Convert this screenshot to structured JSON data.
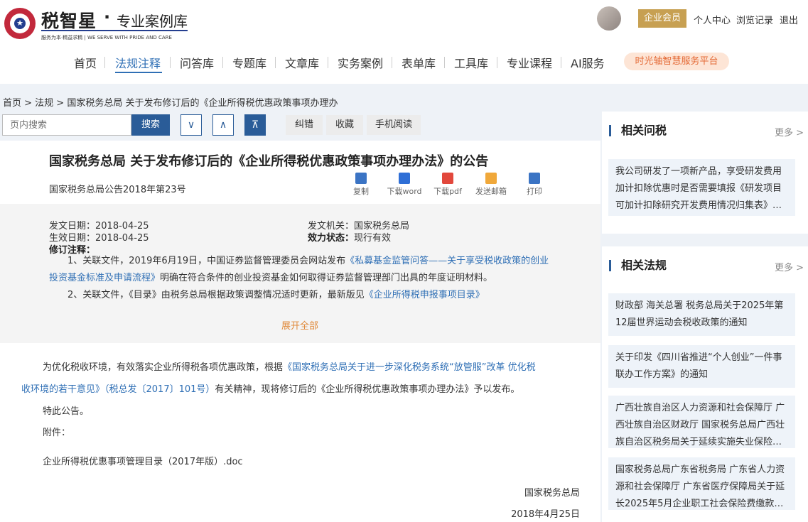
{
  "header": {
    "brand": "税智星",
    "brand_dot": "·",
    "brand_sub": "专业案例库",
    "slogan": "服务为本·精益求精 | WE SERVE WITH PRIDE AND CARE",
    "vip_label": "企业会员",
    "links": [
      "个人中心",
      "浏览记录",
      "退出"
    ]
  },
  "nav": {
    "items": [
      "首页",
      "法规注释",
      "问答库",
      "专题库",
      "文章库",
      "实务案例",
      "表单库",
      "工具库",
      "专业课程",
      "AI服务"
    ],
    "active": "法规注释",
    "special": "时光轴智慧服务平台"
  },
  "breadcrumb": "首页 > 法规 > 国家税务总局 关于发布修订后的《企业所得税优惠政策事项办理办",
  "toolbar": {
    "search_placeholder": "页内搜索",
    "search_label": "搜索",
    "down_arrow": "∨",
    "up_arrow": "∧",
    "top_arrow": "⊼",
    "buttons": [
      "纠错",
      "收藏",
      "手机阅读"
    ]
  },
  "document": {
    "title": "国家税务总局 关于发布修订后的《企业所得税优惠政策事项办理办法》的公告",
    "number": "国家税务总局公告2018年第23号",
    "tools": [
      {
        "label": "复制",
        "icon": "copy-icon",
        "color": "#3b74c4"
      },
      {
        "label": "下载word",
        "icon": "word-icon",
        "color": "#2f6fd6"
      },
      {
        "label": "下载pdf",
        "icon": "pdf-icon",
        "color": "#e2483c"
      },
      {
        "label": "发送邮箱",
        "icon": "mail-icon",
        "color": "#f0a83a"
      },
      {
        "label": "打印",
        "icon": "print-icon",
        "color": "#3b74c4"
      }
    ],
    "meta": {
      "issue_date_label": "发文日期：",
      "issue_date": "2018-04-25",
      "effective_date_label": "生效日期：",
      "effective_date": "2018-04-25",
      "issuer_label": "发文机关：",
      "issuer": "国家税务总局",
      "status_label": "效力状态：",
      "status": "现行有效",
      "revision_label": "修订注释："
    },
    "notes": {
      "n1_prefix": "1、关联文件，2019年6月19日，中国证券监督管理委员会网站发布",
      "n1_link_a": "《私募基金监管问答——关于享受税收政策的创业",
      "n1_link_b": "投资基金标准及申请流程》",
      "n1_suffix": "明确在符合条件的创业投资基金如何取得证券监督管理部门出具的年度证明材料。",
      "n2_prefix": "2、关联文件，《目录》由税务总局根据政策调整情况适时更新，最新版见",
      "n2_link": "《企业所得税申报事项目录》"
    },
    "expand": "展开全部",
    "body": {
      "p1_prefix": "为优化税收环境，有效落实企业所得税各项优惠政策，根据",
      "p1_link_a": "《国家税务总局关于进一步深化税务系统“放管服”改革 优化税",
      "p1_link_b": "收环境的若干意见》（税总发〔2017〕101号）",
      "p1_suffix": "有关精神，现将修订后的《企业所得税优惠政策事项办理办法》予以发布。",
      "p2": "特此公告。",
      "p3": "附件：",
      "attachment": "企业所得税优惠事项管理目录（2017年版）.doc",
      "sign_org": "国家税务总局",
      "sign_date": "2018年4月25日"
    }
  },
  "sidebar": {
    "qa": {
      "title": "相关问税",
      "more": "更多 >",
      "items": [
        "我公司研发了一项新产品，享受研发费用加计扣除优惠时是否需要填报《研发项目可加计扣除研究开发费用情况归集表》…"
      ]
    },
    "laws": {
      "title": "相关法规",
      "more": "更多 >",
      "items": [
        "财政部 海关总署 税务总局关于2025年第12届世界运动会税收政策的通知",
        "关于印发《四川省推进“个人创业”一件事联办工作方案》的通知",
        "广西壮族自治区人力资源和社会保障厅 广西壮族自治区财政厅 国家税务总局广西壮族自治区税务局关于延续实施失业保险…",
        "国家税务总局广东省税务局 广东省人力资源和社会保障厅 广东省医疗保障局关于延长2025年5月企业职工社会保险费缴款…"
      ]
    }
  }
}
